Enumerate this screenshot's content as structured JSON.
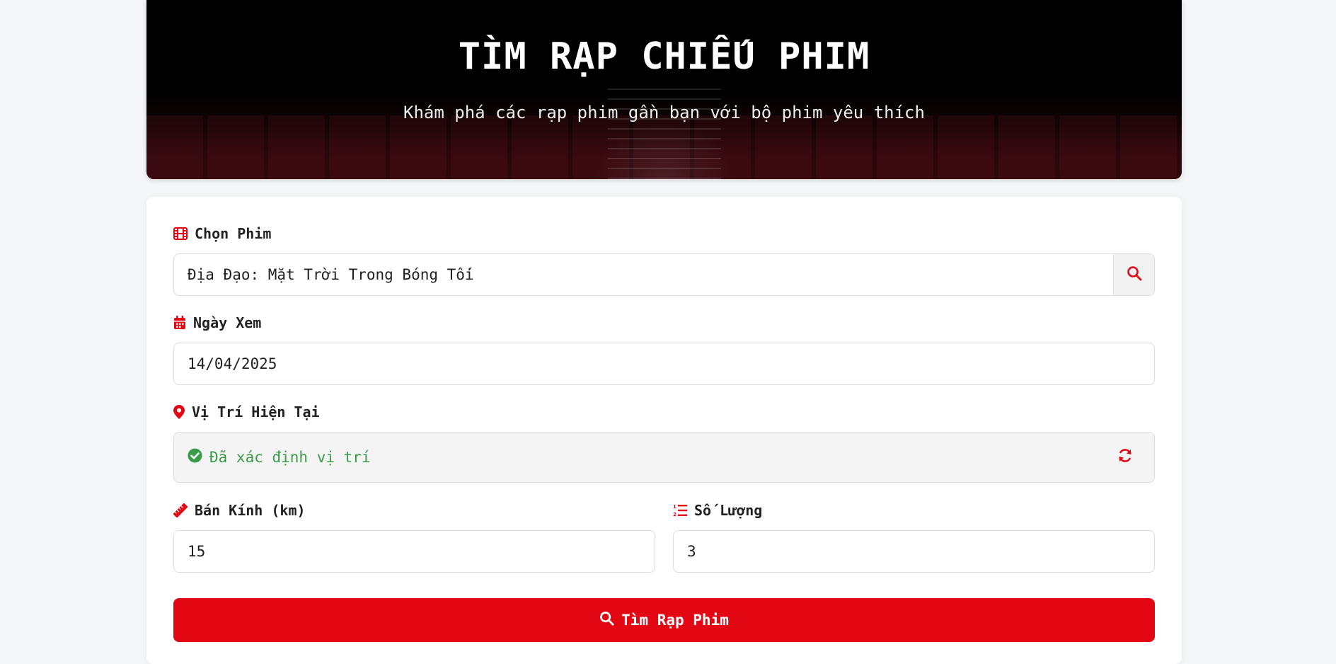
{
  "hero": {
    "title": "TÌM RẠP CHIẾU PHIM",
    "subtitle": "Khám phá các rạp phim gần bạn với bộ phim yêu thích"
  },
  "form": {
    "movie": {
      "label": "Chọn Phim",
      "icon": "film-icon",
      "value": "Địa Đạo: Mặt Trời Trong Bóng Tối",
      "search_icon": "search-icon"
    },
    "date": {
      "label": "Ngày Xem",
      "icon": "calendar-icon",
      "value": "14/04/2025"
    },
    "location": {
      "label": "Vị Trí Hiện Tại",
      "icon": "map-pin-icon",
      "status_text": "Đã xác định vị trí",
      "status_icon": "check-circle-icon",
      "refresh_icon": "refresh-icon"
    },
    "radius": {
      "label": "Bán Kính (km)",
      "icon": "ruler-icon",
      "value": "15"
    },
    "count": {
      "label": "Số Lượng",
      "icon": "numbered-list-icon",
      "value": "3"
    },
    "submit": {
      "label": "Tìm Rạp Phim",
      "icon": "search-icon"
    }
  },
  "colors": {
    "accent": "#e30613",
    "success": "#3a9b48",
    "background": "#f5f6f8"
  }
}
